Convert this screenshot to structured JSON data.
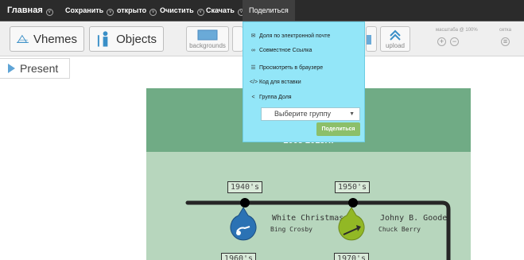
{
  "menubar": {
    "home": "Главная",
    "save": "Сохранить",
    "open": "открыто",
    "clear": "Очистить",
    "download": "Скачать",
    "share": "Поделиться"
  },
  "toolbar": {
    "themes_label": "Vhemes",
    "objects_label": "Objects",
    "backgrounds_label": "backgrounds",
    "upload_label": "upload",
    "scale_label": "масштаба @ 100%",
    "grid_label": "сетка",
    "zoom_in": "+",
    "zoom_out": "−",
    "grid_toggle": "≡"
  },
  "present_label": "Present",
  "share_menu": {
    "items": [
      {
        "icon": "envelope-icon",
        "label": "Доля по электронной почте"
      },
      {
        "icon": "link-icon",
        "label": "Совместное Ссылка"
      },
      {
        "icon": "browser-icon",
        "label": "Просмотреть в браузере"
      },
      {
        "icon": "code-icon",
        "label": "Код для вставки"
      },
      {
        "icon": "share-icon",
        "label": "Группа Доля"
      }
    ],
    "group_select_value": "Выберите группу",
    "share_button": "Поделиться"
  },
  "canvas": {
    "subtitle": "2005 2015гг.",
    "decades": [
      "1940's",
      "1950's",
      "1960's",
      "1970's"
    ],
    "songs": [
      {
        "title": "White Christmas",
        "artist": "Bing Crosby",
        "color": "#2b72b4"
      },
      {
        "title": "Johny B. Goode",
        "artist": "Chuck Berry",
        "color": "#92b825"
      }
    ]
  },
  "colors": {
    "menubar_bg": "#2b2b2b",
    "dropdown_bg": "#93e6f8",
    "share_button": "#8cbf6a",
    "canvas_header": "#70ab85",
    "canvas_body": "#b7d6bd"
  }
}
